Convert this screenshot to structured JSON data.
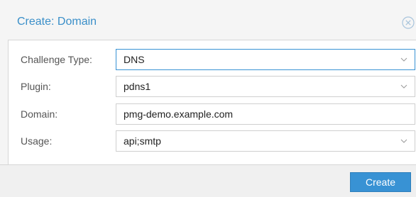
{
  "dialog": {
    "title": "Create: Domain",
    "close_icon": "close-circle-icon"
  },
  "form": {
    "fields": [
      {
        "label": "Challenge Type:",
        "value": "DNS",
        "type": "select",
        "focused": true
      },
      {
        "label": "Plugin:",
        "value": "pdns1",
        "type": "select",
        "focused": false
      },
      {
        "label": "Domain:",
        "value": "pmg-demo.example.com",
        "type": "text",
        "focused": false
      },
      {
        "label": "Usage:",
        "value": "api;smtp",
        "type": "select",
        "focused": false
      }
    ]
  },
  "footer": {
    "create_label": "Create"
  },
  "colors": {
    "accent": "#3892d4",
    "title_text": "#3a8fc9",
    "label_text": "#555555",
    "border": "#cfcfcf"
  }
}
